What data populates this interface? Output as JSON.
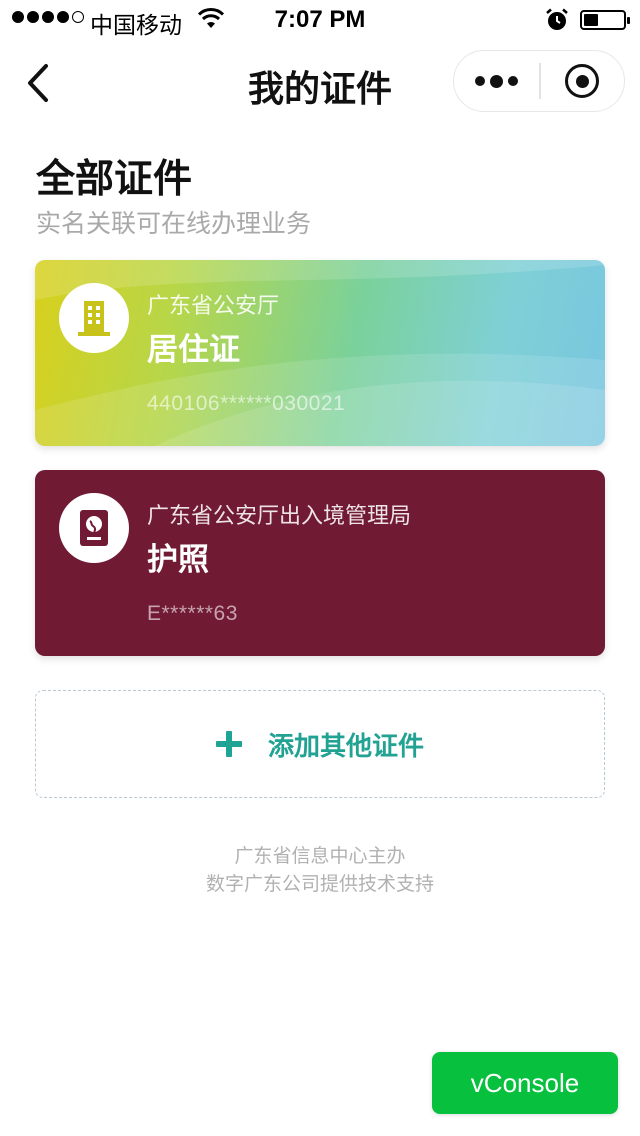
{
  "status_bar": {
    "carrier": "中国移动",
    "time": "7:07 PM"
  },
  "nav": {
    "title": "我的证件",
    "back_icon": "chevron-left-icon",
    "more_icon": "more-dots-icon",
    "close_icon": "target-circle-icon"
  },
  "section": {
    "title": "全部证件",
    "subtitle": "实名关联可在线办理业务"
  },
  "cards": [
    {
      "issuer": "广东省公安厅",
      "name": "居住证",
      "number": "440106******030021",
      "icon": "building-icon",
      "color": "#b6d64a"
    },
    {
      "issuer": "广东省公安厅出入境管理局",
      "name": "护照",
      "number": "E******63",
      "icon": "passport-icon",
      "color": "#701a33"
    }
  ],
  "add_button": {
    "label": "添加其他证件",
    "icon": "plus-icon",
    "color": "#22a293"
  },
  "footer": {
    "line1": "广东省信息中心主办",
    "line2": "数字广东公司提供技术支持"
  },
  "vconsole": {
    "label": "vConsole",
    "color": "#07c13e"
  }
}
